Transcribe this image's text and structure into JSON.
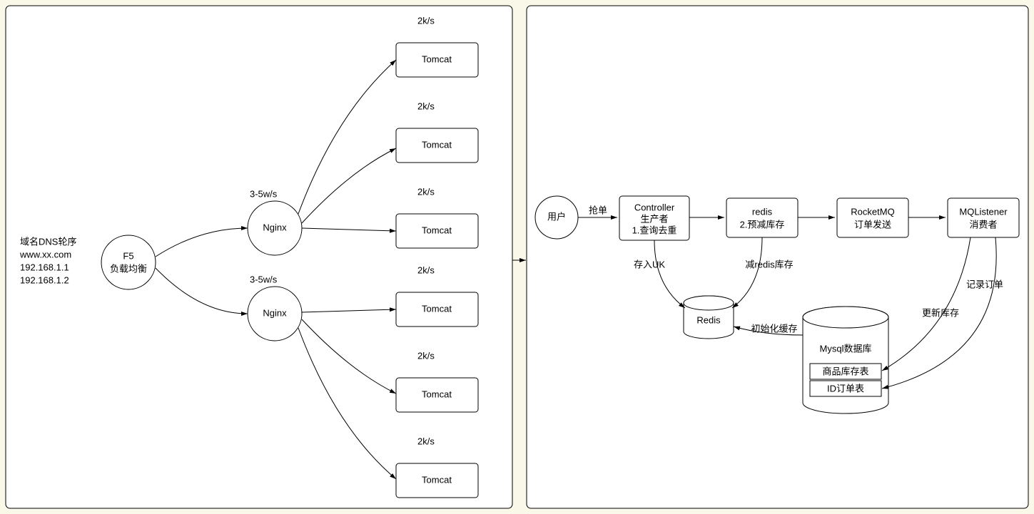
{
  "left": {
    "dns": {
      "l1": "域名DNS轮序",
      "l2": "www.xx.com",
      "l3": "192.168.1.1",
      "l4": "192.168.1.2"
    },
    "f5": {
      "l1": "F5",
      "l2": "负载均衡"
    },
    "nginx1": {
      "label": "Nginx",
      "rate": "3-5w/s"
    },
    "nginx2": {
      "label": "Nginx",
      "rate": "3-5w/s"
    },
    "tomcat1": {
      "label": "Tomcat",
      "rate": "2k/s"
    },
    "tomcat2": {
      "label": "Tomcat",
      "rate": "2k/s"
    },
    "tomcat3": {
      "label": "Tomcat",
      "rate": "2k/s"
    },
    "tomcat4": {
      "label": "Tomcat",
      "rate": "2k/s"
    },
    "tomcat5": {
      "label": "Tomcat",
      "rate": "2k/s"
    },
    "tomcat6": {
      "label": "Tomcat",
      "rate": "2k/s"
    }
  },
  "right": {
    "user": "用户",
    "grab": "抢单",
    "controller": {
      "l1": "Controller",
      "l2": "生产者",
      "l3": "1.查询去重"
    },
    "redis_step": {
      "l1": "redis",
      "l2": "2.预减库存"
    },
    "rocketmq": {
      "l1": "RocketMQ",
      "l2": "订单发送"
    },
    "mqlistener": {
      "l1": "MQListener",
      "l2": "消费者"
    },
    "redis_db": "Redis",
    "save_uk": "存入UK",
    "dec_redis": "减redis库存",
    "init_cache": "初始化缓存",
    "mysql": {
      "title": "Mysql数据库",
      "t1": "商品库存表",
      "t2": "ID订单表"
    },
    "record_order": "记录订单",
    "update_stock": "更新库存"
  }
}
